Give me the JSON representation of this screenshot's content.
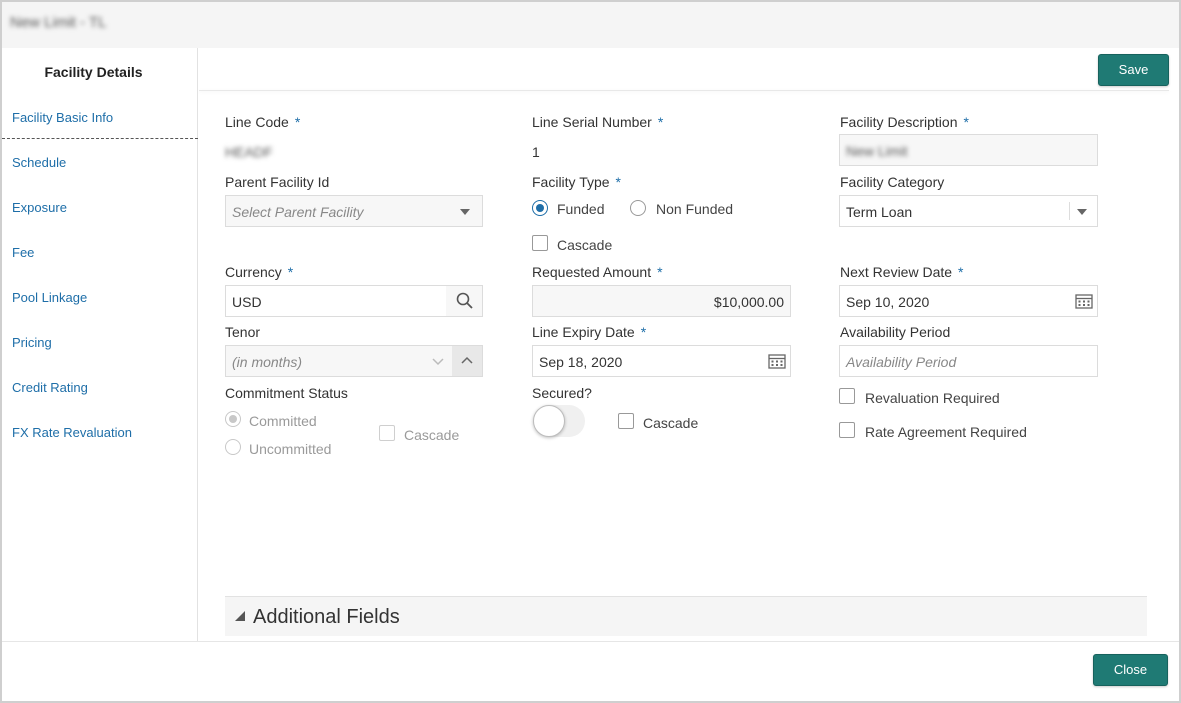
{
  "window": {
    "title": "New Limit - TL"
  },
  "sidebar": {
    "title": "Facility Details",
    "items": [
      {
        "label": "Facility Basic Info"
      },
      {
        "label": "Schedule"
      },
      {
        "label": "Exposure"
      },
      {
        "label": "Fee"
      },
      {
        "label": "Pool Linkage"
      },
      {
        "label": "Pricing"
      },
      {
        "label": "Credit Rating"
      },
      {
        "label": "FX Rate Revaluation"
      }
    ]
  },
  "toolbar": {
    "save_label": "Save"
  },
  "form": {
    "line_code": {
      "label": "Line Code",
      "required": "*",
      "value": "HEADF"
    },
    "line_serial_number": {
      "label": "Line Serial Number",
      "required": "*",
      "value": "1"
    },
    "facility_description": {
      "label": "Facility Description",
      "required": "*",
      "value": "New Limit"
    },
    "parent_facility_id": {
      "label": "Parent Facility Id",
      "placeholder": "Select Parent Facility"
    },
    "facility_type": {
      "label": "Facility Type",
      "required": "*",
      "options": [
        "Funded",
        "Non Funded"
      ],
      "selected": "Funded",
      "cascade_label": "Cascade"
    },
    "facility_category": {
      "label": "Facility Category",
      "value": "Term Loan"
    },
    "currency": {
      "label": "Currency",
      "required": "*",
      "value": "USD"
    },
    "requested_amount": {
      "label": "Requested Amount",
      "required": "*",
      "value": "$10,000.00"
    },
    "next_review_date": {
      "label": "Next Review Date",
      "required": "*",
      "value": "Sep 10, 2020"
    },
    "tenor": {
      "label": "Tenor",
      "placeholder": "(in months)"
    },
    "line_expiry_date": {
      "label": "Line Expiry Date",
      "required": "*",
      "value": "Sep 18, 2020"
    },
    "availability_period": {
      "label": "Availability Period",
      "placeholder": "Availability Period"
    },
    "commitment_status": {
      "label": "Commitment Status",
      "options": [
        "Committed",
        "Uncommitted"
      ],
      "selected": "Committed",
      "cascade_label": "Cascade"
    },
    "secured": {
      "label": "Secured?",
      "cascade_label": "Cascade"
    },
    "revaluation_required": {
      "label": "Revaluation Required"
    },
    "rate_agreement_required": {
      "label": "Rate Agreement Required"
    }
  },
  "additional_fields": {
    "title": "Additional Fields"
  },
  "footer": {
    "close_label": "Close"
  },
  "colors": {
    "accent": "#1f7a74",
    "link": "#1e6ea8"
  },
  "icons": {
    "search": "search-icon",
    "calendar": "calendar-icon",
    "dropdown": "chevron-down-icon"
  }
}
